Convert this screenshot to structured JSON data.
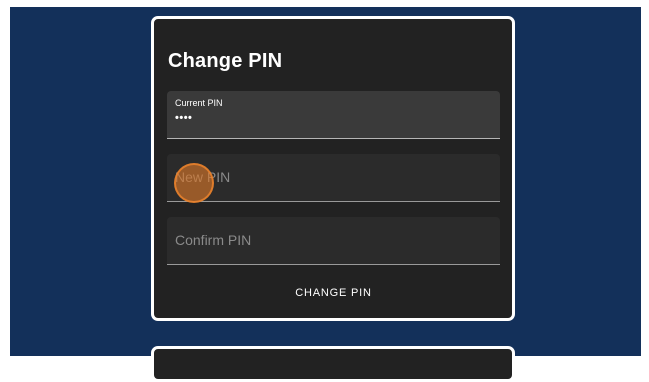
{
  "form": {
    "title": "Change PIN",
    "current_pin": {
      "label": "Current PIN",
      "value": "••••"
    },
    "new_pin": {
      "placeholder": "New PIN"
    },
    "confirm_pin": {
      "placeholder": "Confirm PIN"
    },
    "submit_label": "CHANGE PIN"
  },
  "colors": {
    "page_background": "#13305a",
    "card_background": "#222222",
    "card_border": "#ffffff",
    "cursor_highlight": "#dc7828"
  }
}
